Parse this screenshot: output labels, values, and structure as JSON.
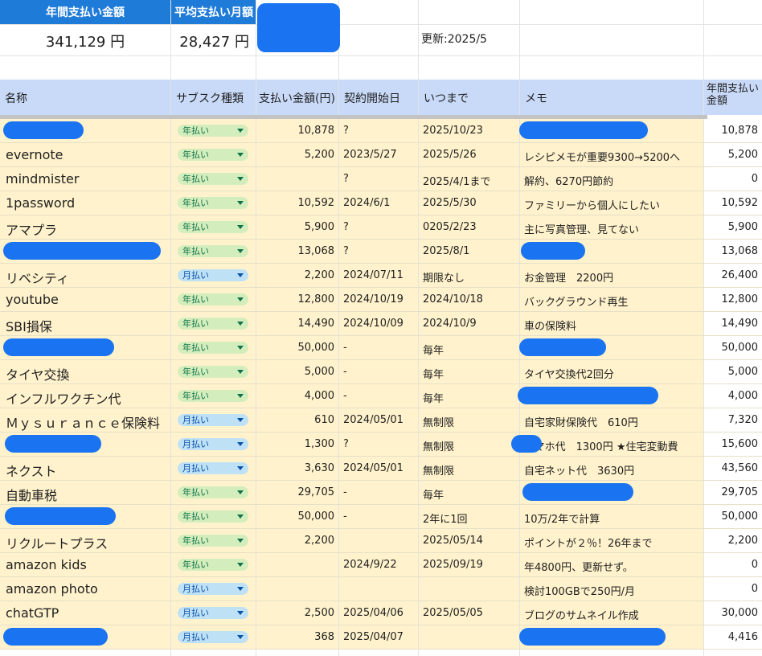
{
  "summary": {
    "annual_label": "年間支払い金額",
    "annual_value": "341,129 円",
    "monthly_label": "平均支払い月額",
    "monthly_value": "28,427 円",
    "updated": "更新:2025/5"
  },
  "headers": {
    "name": "名称",
    "type": "サブスク種類",
    "amount": "支払い金額(円)",
    "start": "契約開始日",
    "until": "いつまで",
    "memo": "メモ",
    "annual": "年間支払い金額"
  },
  "colors": {
    "accent": "#1f7bd8",
    "header_bg": "#c9daf8",
    "row_bg": "#fff2cc",
    "redaction": "#1a73f0"
  },
  "rows": [
    {
      "name": "",
      "type": "年払い",
      "amount": "10,878",
      "start": "?",
      "until": "2025/10/23",
      "memo": "",
      "annual": "10,878"
    },
    {
      "name": "evernote",
      "type": "年払い",
      "amount": "5,200",
      "start": "2023/5/27",
      "until": "2025/5/26",
      "memo": "レシピメモが重要9300→5200へ",
      "annual": "5,200"
    },
    {
      "name": "mindmister",
      "type": "年払い",
      "amount": "",
      "start": "?",
      "until": "2025/4/1まで",
      "memo": "解約、6270円節約",
      "annual": "0"
    },
    {
      "name": "1password",
      "type": "年払い",
      "amount": "10,592",
      "start": "2024/6/1",
      "until": "2025/5/30",
      "memo": "ファミリーから個人にしたい",
      "annual": "10,592"
    },
    {
      "name": "アマプラ",
      "type": "年払い",
      "amount": "5,900",
      "start": "?",
      "until": "0205/2/23",
      "memo": "主に写真管理、見てない",
      "annual": "5,900"
    },
    {
      "name": "",
      "type": "年払い",
      "amount": "13,068",
      "start": "?",
      "until": "2025/8/1",
      "memo": "",
      "annual": "13,068"
    },
    {
      "name": "リベシティ",
      "type": "月払い",
      "amount": "2,200",
      "start": "2024/07/11",
      "until": "期限なし",
      "memo": "お金管理　2200円",
      "annual": "26,400"
    },
    {
      "name": "youtube",
      "type": "年払い",
      "amount": "12,800",
      "start": "2024/10/19",
      "until": "2024/10/18",
      "memo": "バックグラウンド再生",
      "annual": "12,800"
    },
    {
      "name": "SBI損保",
      "type": "年払い",
      "amount": "14,490",
      "start": "2024/10/09",
      "until": "2024/10/9",
      "memo": "車の保険料",
      "annual": "14,490"
    },
    {
      "name": "",
      "type": "年払い",
      "amount": "50,000",
      "start": "-",
      "until": "毎年",
      "memo": "",
      "annual": "50,000"
    },
    {
      "name": "タイヤ交換",
      "type": "年払い",
      "amount": "5,000",
      "start": "-",
      "until": "毎年",
      "memo": "タイヤ交換代2回分",
      "annual": "5,000"
    },
    {
      "name": "インフルワクチン代",
      "type": "年払い",
      "amount": "4,000",
      "start": "-",
      "until": "毎年",
      "memo": "",
      "annual": "4,000"
    },
    {
      "name": "Ｍｙｓｕｒａｎｃｅ保険料",
      "type": "月払い",
      "amount": "610",
      "start": "2024/05/01",
      "until": "無制限",
      "memo": "自宅家財保険代　610円",
      "annual": "7,320"
    },
    {
      "name": "",
      "type": "月払い",
      "amount": "1,300",
      "start": "?",
      "until": "無制限",
      "memo": "スマホ代　1300円 ★住宅変動費",
      "annual": "15,600"
    },
    {
      "name": "ネクスト",
      "type": "月払い",
      "amount": "3,630",
      "start": "2024/05/01",
      "until": "無制限",
      "memo": "自宅ネット代　3630円",
      "annual": "43,560"
    },
    {
      "name": "自動車税",
      "type": "年払い",
      "amount": "29,705",
      "start": "-",
      "until": "毎年",
      "memo": "",
      "annual": "29,705"
    },
    {
      "name": "",
      "type": "年払い",
      "amount": "50,000",
      "start": "-",
      "until": "2年に1回",
      "memo": "10万/2年で計算",
      "annual": "50,000"
    },
    {
      "name": "リクルートプラス",
      "type": "年払い",
      "amount": "2,200",
      "start": "",
      "until": "2025/05/14",
      "memo": "ポイントが２％！26年まで",
      "annual": "2,200"
    },
    {
      "name": "amazon kids",
      "type": "年払い",
      "amount": "",
      "start": "2024/9/22",
      "until": "2025/09/19",
      "memo": "年4800円、更新せず。",
      "annual": "0"
    },
    {
      "name": "amazon photo",
      "type": "月払い",
      "amount": "",
      "start": "",
      "until": "",
      "memo": "検討100GBで250円/月",
      "annual": "0"
    },
    {
      "name": "chatGTP",
      "type": "月払い",
      "amount": "2,500",
      "start": "2025/04/06",
      "until": "2025/05/05",
      "memo": "ブログのサムネイル作成",
      "annual": "30,000"
    },
    {
      "name": "",
      "type": "月払い",
      "amount": "368",
      "start": "2025/04/07",
      "until": "",
      "memo": "",
      "annual": "4,416"
    }
  ]
}
